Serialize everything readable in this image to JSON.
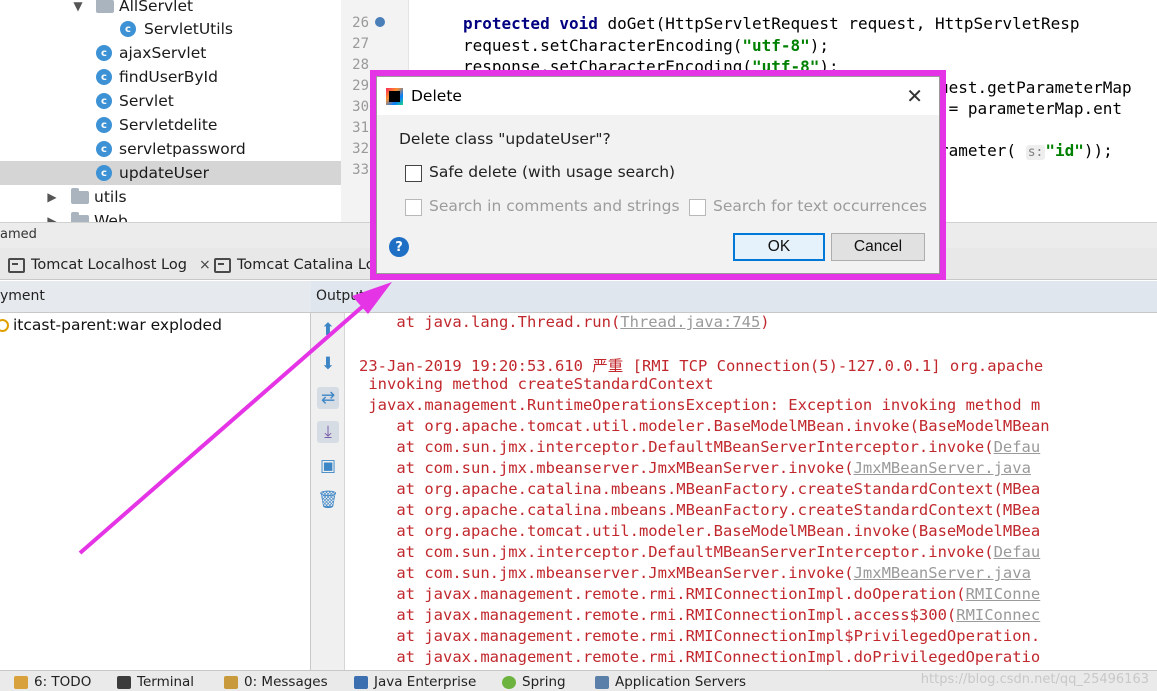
{
  "project_tree": {
    "items": [
      {
        "label": "AllServlet",
        "type": "folder"
      },
      {
        "label": "ServletUtils",
        "type": "class"
      },
      {
        "label": "ajaxServlet",
        "type": "class"
      },
      {
        "label": "findUserById",
        "type": "class"
      },
      {
        "label": "Servlet",
        "type": "class"
      },
      {
        "label": "Servletdelite",
        "type": "class"
      },
      {
        "label": "servletpassword",
        "type": "class"
      },
      {
        "label": "updateUser",
        "type": "class",
        "selected": true
      },
      {
        "label": "utils",
        "type": "folder"
      },
      {
        "label": "Web",
        "type": "folder"
      }
    ]
  },
  "editor": {
    "line_numbers": [
      "26",
      "27",
      "28",
      "29",
      "30",
      "31",
      "32",
      "33"
    ],
    "code": {
      "l26_kw1": "protected",
      "l26_kw2": "void",
      "l26_rest": " doGet(HttpServletRequest request, HttpServletResp",
      "l27_a": "request.setCharacterEncoding(",
      "l27_s": "\"utf-8\"",
      "l27_b": ");",
      "l28_a": "response.setCharacterEncoding(",
      "l28_s": "\"utf-8\"",
      "l28_b": ");",
      "l29": "uest.getParameterMap",
      "l30": " = parameterMap.ent",
      "l32_a": "rameter(",
      "l32_hint": "s:",
      "l32_s": "\"id\"",
      "l32_b": "));"
    }
  },
  "services_title": "amed",
  "tabs": [
    {
      "label": "Tomcat Localhost Log",
      "close": "×"
    },
    {
      "label": "Tomcat Catalina Log"
    }
  ],
  "headers": {
    "deployment": "yment",
    "output": "Output"
  },
  "deployment_item": "itcast-parent:war exploded",
  "console_lines": [
    {
      "text": "    at java.lang.Thread.run(",
      "link": "Thread.java:745",
      "tail": ")"
    },
    {
      "text": "23-Jan-2019 19:20:53.610 严重 [RMI TCP Connection(5)-127.0.0.1] org.apache"
    },
    {
      "text": " invoking method createStandardContext"
    },
    {
      "text": " javax.management.RuntimeOperationsException: Exception invoking method m"
    },
    {
      "text": "    at org.apache.tomcat.util.modeler.BaseModelMBean.invoke(BaseModelMBean"
    },
    {
      "text": "    at com.sun.jmx.interceptor.DefaultMBeanServerInterceptor.invoke(",
      "link": "Defau"
    },
    {
      "text": "    at com.sun.jmx.mbeanserver.JmxMBeanServer.invoke(",
      "link": "JmxMBeanServer.java"
    },
    {
      "text": "    at org.apache.catalina.mbeans.MBeanFactory.createStandardContext(MBea"
    },
    {
      "text": "    at org.apache.catalina.mbeans.MBeanFactory.createStandardContext(MBea"
    },
    {
      "text": "    at org.apache.tomcat.util.modeler.BaseModelMBean.invoke(BaseModelMBea"
    },
    {
      "text": "    at com.sun.jmx.interceptor.DefaultMBeanServerInterceptor.invoke(",
      "link": "Defau"
    },
    {
      "text": "    at com.sun.jmx.mbeanserver.JmxMBeanServer.invoke(",
      "link": "JmxMBeanServer.java"
    },
    {
      "text": "    at javax.management.remote.rmi.RMIConnectionImpl.doOperation(",
      "link": "RMIConne"
    },
    {
      "text": "    at javax.management.remote.rmi.RMIConnectionImpl.access$300(",
      "link": "RMIConnec"
    },
    {
      "text": "    at javax.management.remote.rmi.RMIConnectionImpl$PrivilegedOperation."
    },
    {
      "text": "    at javax.management.remote.rmi.RMIConnectionImpl.doPrivilegedOperatio"
    }
  ],
  "bottom_bar": {
    "todo": "6: TODO",
    "terminal": "Terminal",
    "messages": "0: Messages",
    "java_enterprise": "Java Enterprise",
    "spring": "Spring",
    "app_servers": "Application Servers",
    "watermark": "https://blog.csdn.net/qq_25496163"
  },
  "dialog": {
    "title": "Delete",
    "close": "✕",
    "question": "Delete class \"updateUser\"?",
    "safe_delete_label": "Safe delete (with usage search)",
    "search_comments_label": "Search in comments and strings",
    "search_text_label": "Search for text occurrences",
    "ok_label": "OK",
    "cancel_label": "Cancel",
    "help": "?"
  },
  "colors": {
    "highlight_outline": "#e534e5",
    "arrow": "#e534e5",
    "console_error": "#c1282d",
    "keyword": "#000080",
    "string": "#008000"
  }
}
